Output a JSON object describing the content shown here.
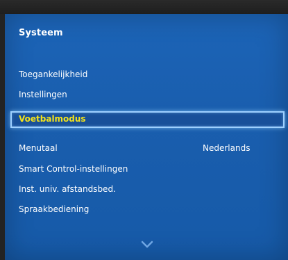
{
  "panel": {
    "title": "Systeem"
  },
  "menu": {
    "items": [
      {
        "label": "Toegankelijkheid"
      },
      {
        "label": "Instellingen"
      },
      {
        "label": "Voetbalmodus",
        "focused": true
      },
      {
        "label": "Menutaal",
        "value": "Nederlands"
      },
      {
        "label": "Smart Control-instellingen"
      },
      {
        "label": "Inst. univ. afstandsbed."
      },
      {
        "label": "Spraakbediening"
      }
    ]
  },
  "scroll": {
    "icon": "chevron-down-icon"
  },
  "colors": {
    "panel_blue": "#1a5eae",
    "focus_text": "#f3e21a",
    "focus_border": "#9ed0ff",
    "text": "#ffffff"
  }
}
